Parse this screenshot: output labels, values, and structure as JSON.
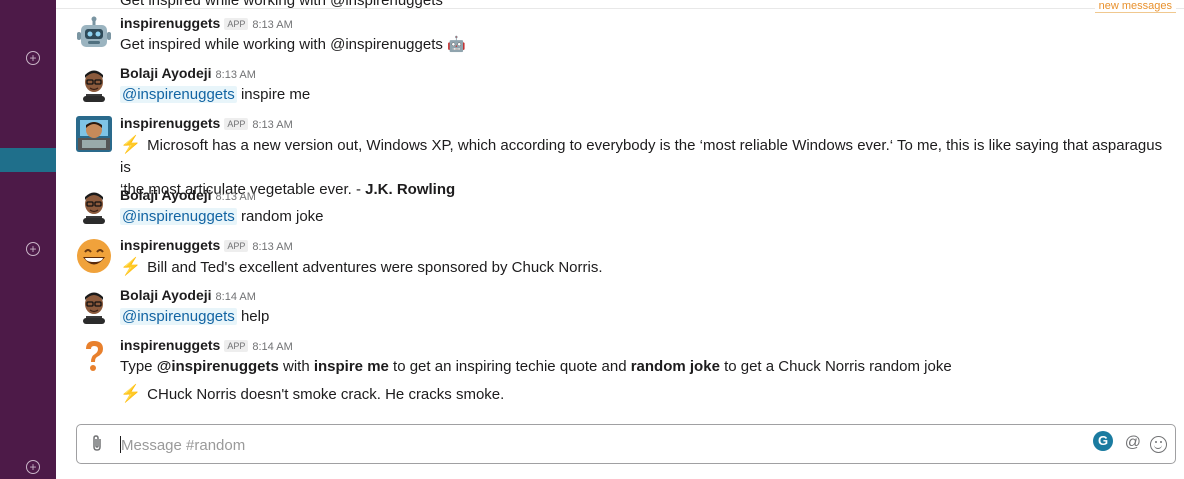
{
  "top_clipped_text": "Get inspired while working with @inspirenuggets",
  "new_messages_label": "new messages",
  "messages": [
    {
      "sender": "inspirenuggets",
      "badge": "APP",
      "time": "8:13 AM",
      "text": "Get inspired while working with @inspirenuggets 🤖",
      "avatar": "robot-emoji"
    },
    {
      "sender": "Bolaji Ayodeji",
      "time": "8:13 AM",
      "mention": "@inspirenuggets",
      "text": "inspire me",
      "avatar": "user-avatar"
    },
    {
      "sender": "inspirenuggets",
      "badge": "APP",
      "time": "8:13 AM",
      "line1": "Microsoft has a new version out, Windows XP, which according to everybody is the ‘most reliable Windows ever.‘ To me, this is like saying that asparagus is",
      "line2": "‘the most articulate vegetable ever. - ",
      "author": "J.K. Rowling",
      "avatar": "coder-avatar"
    },
    {
      "sender": "Bolaji Ayodeji",
      "time": "8:13 AM",
      "mention": "@inspirenuggets",
      "text": "random joke",
      "avatar": "user-avatar"
    },
    {
      "sender": "inspirenuggets",
      "badge": "APP",
      "time": "8:13 AM",
      "text": "Bill and Ted's excellent adventures were sponsored by Chuck Norris.",
      "avatar": "grin-emoji"
    },
    {
      "sender": "Bolaji Ayodeji",
      "time": "8:14 AM",
      "mention": "@inspirenuggets",
      "text": "help",
      "avatar": "user-avatar"
    },
    {
      "sender": "inspirenuggets",
      "badge": "APP",
      "time": "8:14 AM",
      "help": {
        "p1": "Type ",
        "b1": "@inspirenuggets",
        "p2": " with ",
        "b2": "inspire me",
        "p3": " to get an inspiring techie quote and ",
        "b3": "random joke",
        "p4": " to get a Chuck Norris random joke"
      },
      "text2": "CHuck Norris doesn't smoke crack. He cracks smoke.",
      "avatar": "question-emoji"
    }
  ],
  "composer": {
    "placeholder": "Message #random",
    "grammarly_letter": "G",
    "at_symbol": "@"
  },
  "colors": {
    "sidebar": "#4d1a48",
    "sidebar_active": "#1f6f8b",
    "mention": "#1264a3",
    "bolt": "#f4a623"
  }
}
